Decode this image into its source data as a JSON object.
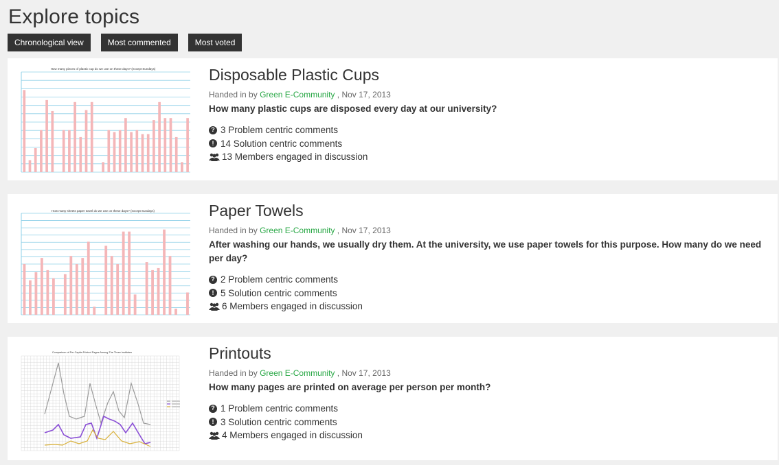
{
  "page": {
    "title": "Explore topics"
  },
  "views": [
    "Chronological view",
    "Most commented",
    "Most voted"
  ],
  "colors": {
    "author": "#28a745",
    "bar": "#f4b6b8",
    "button_bg": "#333333"
  },
  "topics": [
    {
      "title": "Disposable Plastic Cups",
      "meta_prefix": "Handed in by",
      "author": "Green E-Community",
      "date": ", Nov 17, 2013",
      "question": "How many plastic cups are disposed every day at our university?",
      "problem_comments": "3 Problem centric comments",
      "solution_comments": "14 Solution centric comments",
      "members": "13 Members engaged in discussion",
      "thumb_title": "How many pieces of plastic cup do we use on these days? (except Sundays)"
    },
    {
      "title": "Paper Towels",
      "meta_prefix": "Handed in by",
      "author": "Green E-Community",
      "date": ", Nov 17, 2013",
      "question": "After washing our hands, we usually dry them. At the university, we use paper towels for this purpose. How many do we need per day?",
      "problem_comments": "2 Problem centric comments",
      "solution_comments": "5 Solution centric comments",
      "members": "6 Members engaged in discussion",
      "thumb_title": "How many sheets paper towel do we use on these days? (except Sundays)"
    },
    {
      "title": "Printouts",
      "meta_prefix": "Handed in by",
      "author": "Green E-Community",
      "date": ", Nov 17, 2013",
      "question": "How many pages are printed on average per person per month?",
      "problem_comments": "1 Problem centric comments",
      "solution_comments": "3 Solution centric comments",
      "members": "4 Members engaged in discussion",
      "thumb_title": "Comparison of Per Capita Printed Pages Among The Three Institutes"
    }
  ]
}
